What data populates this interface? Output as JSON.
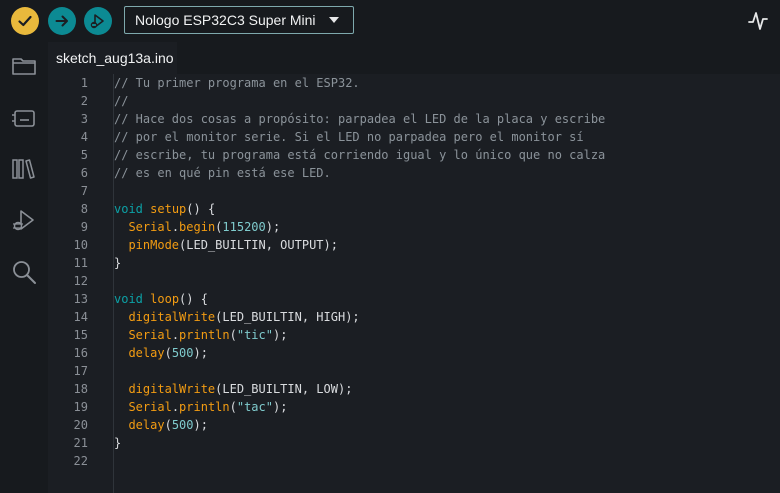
{
  "toolbar": {
    "verify_icon": "check-icon",
    "upload_icon": "arrow-right-icon",
    "debug_icon": "debug-play-icon",
    "board": "Nologo ESP32C3 Super Mini",
    "serial_plotter_icon": "pulse-icon"
  },
  "sidebar": {
    "items": [
      {
        "icon": "folder-icon"
      },
      {
        "icon": "board-manager-icon"
      },
      {
        "icon": "library-icon"
      },
      {
        "icon": "debug-icon"
      },
      {
        "icon": "search-icon"
      }
    ]
  },
  "tab": {
    "label": "sketch_aug13a.ino"
  },
  "editor": {
    "lines": [
      {
        "n": "1",
        "tokens": [
          {
            "t": "cm",
            "v": "// Tu primer programa en el ESP32."
          }
        ]
      },
      {
        "n": "2",
        "tokens": [
          {
            "t": "cm",
            "v": "//"
          }
        ]
      },
      {
        "n": "3",
        "tokens": [
          {
            "t": "cm",
            "v": "// Hace dos cosas a propósito: parpadea el LED de la placa y escribe"
          }
        ]
      },
      {
        "n": "4",
        "tokens": [
          {
            "t": "cm",
            "v": "// por el monitor serie. Si el LED no parpadea pero el monitor sí"
          }
        ]
      },
      {
        "n": "5",
        "tokens": [
          {
            "t": "cm",
            "v": "// escribe, tu programa está corriendo igual y lo único que no calza"
          }
        ]
      },
      {
        "n": "6",
        "tokens": [
          {
            "t": "cm",
            "v": "// es en qué pin está ese LED."
          }
        ]
      },
      {
        "n": "7",
        "tokens": []
      },
      {
        "n": "8",
        "tokens": [
          {
            "t": "kw",
            "v": "void"
          },
          {
            "t": "plain",
            "v": " "
          },
          {
            "t": "fn",
            "v": "setup"
          },
          {
            "t": "plain",
            "v": "() {"
          }
        ]
      },
      {
        "n": "9",
        "tokens": [
          {
            "t": "plain",
            "v": "  "
          },
          {
            "t": "fn",
            "v": "Serial"
          },
          {
            "t": "plain",
            "v": "."
          },
          {
            "t": "fn",
            "v": "begin"
          },
          {
            "t": "plain",
            "v": "("
          },
          {
            "t": "num",
            "v": "115200"
          },
          {
            "t": "plain",
            "v": ");"
          }
        ]
      },
      {
        "n": "10",
        "tokens": [
          {
            "t": "plain",
            "v": "  "
          },
          {
            "t": "fn",
            "v": "pinMode"
          },
          {
            "t": "plain",
            "v": "(LED_BUILTIN, OUTPUT);"
          }
        ]
      },
      {
        "n": "11",
        "tokens": [
          {
            "t": "plain",
            "v": "}"
          }
        ]
      },
      {
        "n": "12",
        "tokens": []
      },
      {
        "n": "13",
        "tokens": [
          {
            "t": "kw",
            "v": "void"
          },
          {
            "t": "plain",
            "v": " "
          },
          {
            "t": "fn",
            "v": "loop"
          },
          {
            "t": "plain",
            "v": "() {"
          }
        ]
      },
      {
        "n": "14",
        "tokens": [
          {
            "t": "plain",
            "v": "  "
          },
          {
            "t": "fn",
            "v": "digitalWrite"
          },
          {
            "t": "plain",
            "v": "(LED_BUILTIN, HIGH);"
          }
        ]
      },
      {
        "n": "15",
        "tokens": [
          {
            "t": "plain",
            "v": "  "
          },
          {
            "t": "fn",
            "v": "Serial"
          },
          {
            "t": "plain",
            "v": "."
          },
          {
            "t": "fn",
            "v": "println"
          },
          {
            "t": "plain",
            "v": "("
          },
          {
            "t": "str",
            "v": "\"tic\""
          },
          {
            "t": "plain",
            "v": ");"
          }
        ]
      },
      {
        "n": "16",
        "tokens": [
          {
            "t": "plain",
            "v": "  "
          },
          {
            "t": "fn",
            "v": "delay"
          },
          {
            "t": "plain",
            "v": "("
          },
          {
            "t": "num",
            "v": "500"
          },
          {
            "t": "plain",
            "v": ");"
          }
        ]
      },
      {
        "n": "17",
        "tokens": []
      },
      {
        "n": "18",
        "tokens": [
          {
            "t": "plain",
            "v": "  "
          },
          {
            "t": "fn",
            "v": "digitalWrite"
          },
          {
            "t": "plain",
            "v": "(LED_BUILTIN, LOW);"
          }
        ]
      },
      {
        "n": "19",
        "tokens": [
          {
            "t": "plain",
            "v": "  "
          },
          {
            "t": "fn",
            "v": "Serial"
          },
          {
            "t": "plain",
            "v": "."
          },
          {
            "t": "fn",
            "v": "println"
          },
          {
            "t": "plain",
            "v": "("
          },
          {
            "t": "str",
            "v": "\"tac\""
          },
          {
            "t": "plain",
            "v": ");"
          }
        ]
      },
      {
        "n": "20",
        "tokens": [
          {
            "t": "plain",
            "v": "  "
          },
          {
            "t": "fn",
            "v": "delay"
          },
          {
            "t": "plain",
            "v": "("
          },
          {
            "t": "num",
            "v": "500"
          },
          {
            "t": "plain",
            "v": ");"
          }
        ]
      },
      {
        "n": "21",
        "tokens": [
          {
            "t": "plain",
            "v": "}"
          }
        ]
      },
      {
        "n": "22",
        "tokens": []
      }
    ]
  },
  "colors": {
    "verify": "#e9b93c",
    "accent": "#0c8a93",
    "keyword": "#0ca1a6",
    "function": "#f39c12",
    "literal": "#7fcbcd",
    "comment": "#8b939a"
  }
}
